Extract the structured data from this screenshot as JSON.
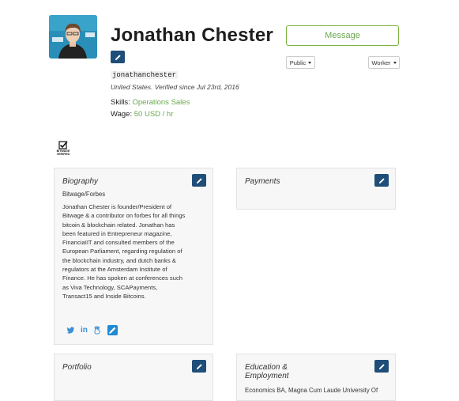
{
  "profile": {
    "name": "Jonathan Chester",
    "handle": "jonathanchester",
    "location": "United States. Verified since Jul 23rd, 2016",
    "skills_label": "Skills:",
    "skills_value": "Operations Sales",
    "wage_label": "Wage:",
    "wage_value": "50 USD / hr"
  },
  "actions": {
    "message_label": "Message",
    "visibility_label": "Public",
    "role_label": "Worker"
  },
  "badge": {
    "text_line1": "BITWAGE",
    "text_line2": "VERIFIED"
  },
  "cards": {
    "biography": {
      "title": "Biography",
      "subtitle": "Bitwage/Forbes",
      "text": "Jonathan Chester is founder/President of Bitwage & a contributor on forbes for all things bitcoin & blockchain related. Jonathan has been featured in Entrepreneur magazine, FinanciaIIT and consulted members of the European Parliament, regarding regulation of the blockchain industry, and dutch banks & regulators at the Amsterdam Institute of Finance. He has spoken at conferences such as Viva Technology, SCAPayments, Transact15 and Inside Bitcoins."
    },
    "payments": {
      "title": "Payments"
    },
    "portfolio": {
      "title": "Portfolio"
    },
    "education": {
      "title_line1": "Education &",
      "title_line2": "Employment",
      "text": "Economics BA, Magna Cum Laude University Of"
    }
  },
  "colors": {
    "accent_green": "#6aa84f",
    "edit_button": "#1f4e79",
    "social_blue": "#3b8fd6"
  },
  "icons": [
    "pencil-icon",
    "twitter-icon",
    "linkedin-icon",
    "angellist-icon",
    "caret-down-icon"
  ]
}
